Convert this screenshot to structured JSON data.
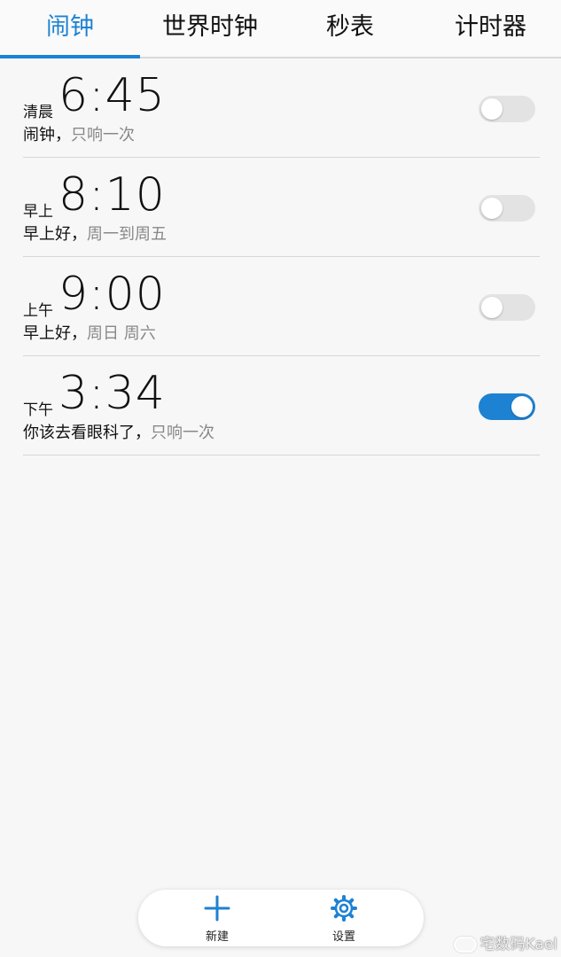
{
  "tabs": [
    {
      "label": "闹钟",
      "active": true
    },
    {
      "label": "世界时钟",
      "active": false
    },
    {
      "label": "秒表",
      "active": false
    },
    {
      "label": "计时器",
      "active": false
    }
  ],
  "alarms": [
    {
      "period": "清晨",
      "time": "6:45",
      "label": "闹钟",
      "separator": "，",
      "repeat": "只响一次",
      "enabled": false
    },
    {
      "period": "早上",
      "time": "8:10",
      "label": "早上好",
      "separator": "，",
      "repeat": "周一到周五",
      "enabled": false
    },
    {
      "period": "上午",
      "time": "9:00",
      "label": "早上好",
      "separator": "，",
      "repeat": "周日 周六",
      "enabled": false
    },
    {
      "period": "下午",
      "time": "3:34",
      "label": "你该去看眼科了",
      "separator": "，",
      "repeat": "只响一次",
      "enabled": true
    }
  ],
  "bottom_bar": {
    "new_label": "新建",
    "settings_label": "设置"
  },
  "watermark": {
    "text": "宅数码Kael"
  },
  "colors": {
    "accent": "#1e82d2",
    "toggle_off": "#e3e3e3",
    "secondary_text": "#888888"
  },
  "icons": {
    "new": "plus-icon",
    "settings": "gear-icon",
    "watermark": "weibo-icon"
  }
}
